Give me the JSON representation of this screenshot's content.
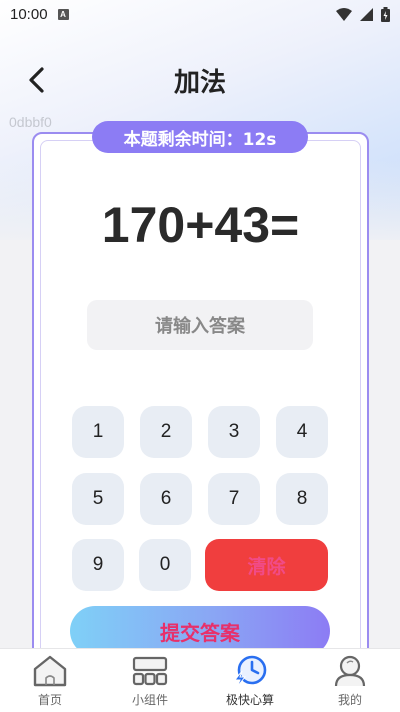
{
  "status_bar": {
    "time": "10:00",
    "indicator": "A"
  },
  "header": {
    "title": "加法",
    "back_icon": "chevron-left-icon"
  },
  "debug_text": "0dbbf0",
  "quiz": {
    "timer_label": "本题剩余时间：12s",
    "question": "170+43=",
    "answer_placeholder": "请输入答案"
  },
  "keypad": {
    "keys": [
      "1",
      "2",
      "3",
      "4",
      "5",
      "6",
      "7",
      "8",
      "9",
      "0"
    ],
    "clear_label": "清除"
  },
  "submit_label": "提交答案",
  "tabs": [
    {
      "label": "首页",
      "icon": "home-icon",
      "active": false
    },
    {
      "label": "小组件",
      "icon": "widgets-icon",
      "active": false
    },
    {
      "label": "极快心算",
      "icon": "fast-timer-icon",
      "active": true
    },
    {
      "label": "我的",
      "icon": "profile-icon",
      "active": false
    }
  ],
  "colors": {
    "accent_purple": "#8c7cf4",
    "clear_red": "#f03e3e",
    "key_bg": "#e8edf4",
    "active_tab_blue": "#2a6ff0"
  }
}
